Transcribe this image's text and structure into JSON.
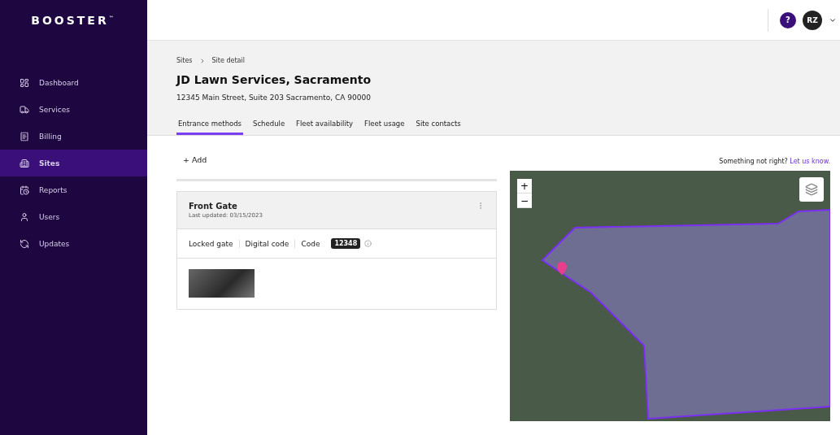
{
  "sidebar": {
    "logo": "BOOSTER",
    "logo_mark": "™",
    "items": [
      {
        "label": "Dashboard",
        "selected": false
      },
      {
        "label": "Services",
        "selected": false
      },
      {
        "label": "Billing",
        "selected": false
      },
      {
        "label": "Sites",
        "selected": true
      },
      {
        "label": "Reports",
        "selected": false
      },
      {
        "label": "Users",
        "selected": false
      },
      {
        "label": "Updates",
        "selected": false
      }
    ]
  },
  "header": {
    "help": "?",
    "avatar": "RZ"
  },
  "breadcrumb": [
    "Sites",
    "Site detail"
  ],
  "title": "JD Lawn Services, Sacramento",
  "address": "12345 Main Street, Suite 203 Sacramento, CA 90000",
  "tabs": [
    {
      "label": "Entrance methods",
      "selected": true
    },
    {
      "label": "Schedule",
      "selected": false
    },
    {
      "label": "Fleet availability",
      "selected": false
    },
    {
      "label": "Fleet usage",
      "selected": false
    },
    {
      "label": "Site contacts",
      "selected": false
    }
  ],
  "add_button": "+ Add",
  "feedback": {
    "text": "Something not right?",
    "link": "Let us know."
  },
  "entrance": {
    "name": "Front Gate",
    "updated": "Last updated: 03/15/2023",
    "attributes": [
      "Locked gate",
      "Digital code"
    ],
    "code_label": "Code",
    "code": "12348"
  },
  "map": {
    "zoom_in": "+",
    "zoom_out": "−"
  }
}
